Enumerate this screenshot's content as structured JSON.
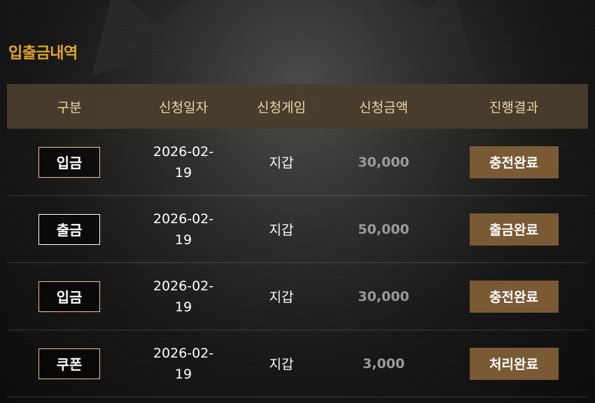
{
  "title": "입출금내역",
  "colors": {
    "accent": "#e3a52a",
    "header_bg": "#4a3e2c",
    "status_bg": "#7a5a35"
  },
  "table": {
    "headers": [
      "구분",
      "신청일자",
      "신청게임",
      "신청금액",
      "진행결과"
    ],
    "rows": [
      {
        "type": "입금",
        "date_line1": "2026-02-",
        "date_line2": "19",
        "game": "지갑",
        "amount": "30,000",
        "status": "충전완료"
      },
      {
        "type": "출금",
        "date_line1": "2026-02-",
        "date_line2": "19",
        "game": "지갑",
        "amount": "50,000",
        "status": "출금완료"
      },
      {
        "type": "입금",
        "date_line1": "2026-02-",
        "date_line2": "19",
        "game": "지갑",
        "amount": "30,000",
        "status": "충전완료"
      },
      {
        "type": "쿠폰",
        "date_line1": "2026-02-",
        "date_line2": "19",
        "game": "지갑",
        "amount": "3,000",
        "status": "처리완료"
      }
    ]
  }
}
